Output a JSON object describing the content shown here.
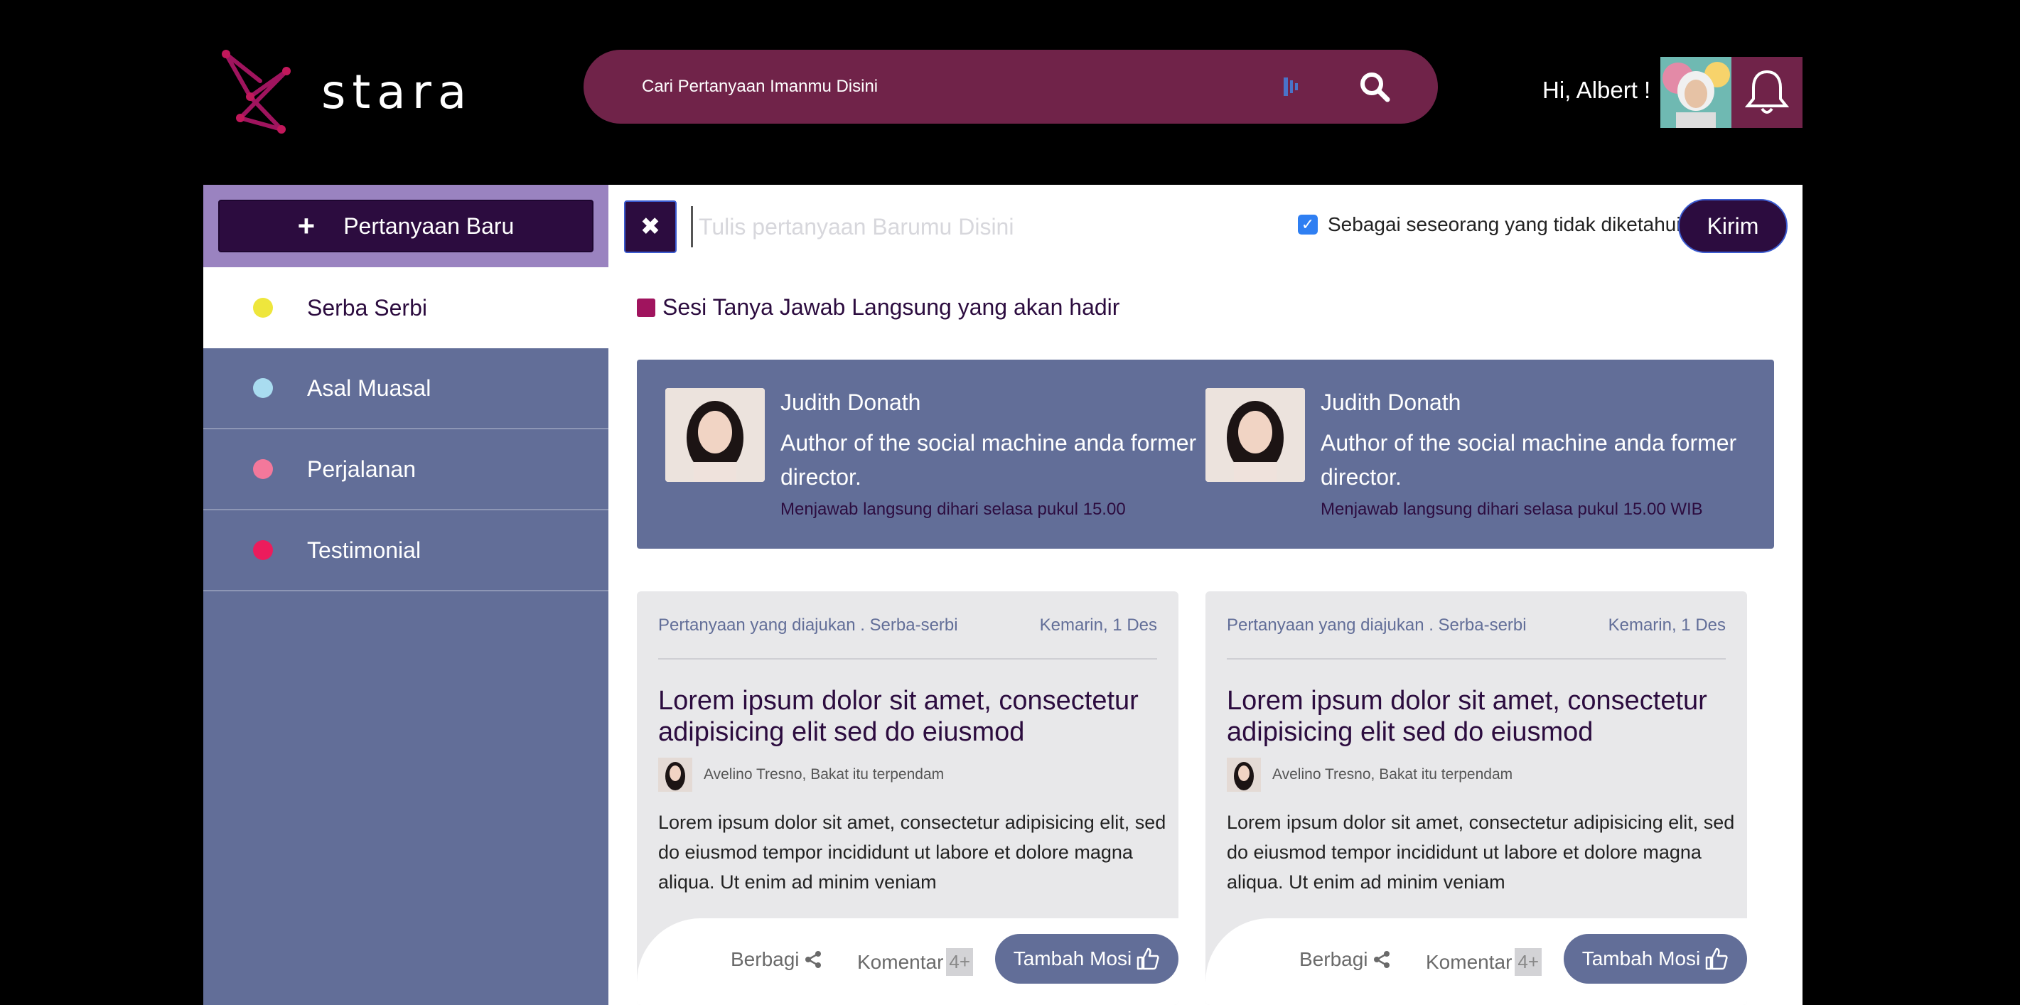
{
  "header": {
    "logo_text": "stara",
    "search_placeholder": "Cari Pertanyaan Imanmu Disini",
    "greeting": "Hi, Albert !"
  },
  "sidebar": {
    "new_question_label": "Pertanyaan Baru",
    "items": [
      {
        "label": "Serba Serbi",
        "color": "#eee63c"
      },
      {
        "label": "Asal Muasal",
        "color": "#a9dcf0"
      },
      {
        "label": "Perjalanan",
        "color": "#f3789b"
      },
      {
        "label": "Testimonial",
        "color": "#ec1c5c"
      }
    ]
  },
  "composer": {
    "placeholder": "Tulis pertanyaan Barumu Disini",
    "anonymous_label": "Sebagai seseorang yang tidak diketahui",
    "anonymous_checked": true,
    "send_label": "Kirim"
  },
  "live_section": {
    "title": "Sesi Tanya Jawab Langsung yang akan hadir",
    "speakers": [
      {
        "name": "Judith Donath",
        "role": "Author of the social machine anda former director.",
        "time": "Menjawab langsung dihari selasa pukul 15.00"
      },
      {
        "name": "Judith Donath",
        "role": "Author of the social machine anda former director.",
        "time": "Menjawab langsung dihari selasa pukul 15.00 WIB"
      }
    ]
  },
  "cards": [
    {
      "meta_left": "Pertanyaan yang diajukan . Serba-serbi",
      "meta_right": "Kemarin, 1 Des",
      "title": "Lorem ipsum dolor sit amet, consectetur adipisicing elit sed do eiusmod",
      "author": "Avelino Tresno, Bakat itu terpendam",
      "body": "Lorem ipsum dolor sit amet, consectetur adipisicing elit, sed do eiusmod tempor incididunt ut labore et dolore magna aliqua. Ut enim ad minim veniam",
      "share_label": "Berbagi",
      "comment_label": "Komentar",
      "comment_count": "4+",
      "upvote_label": "Tambah Mosi"
    },
    {
      "meta_left": "Pertanyaan yang diajukan . Serba-serbi",
      "meta_right": "Kemarin, 1 Des",
      "title": "Lorem ipsum dolor sit amet, consectetur adipisicing elit sed do eiusmod",
      "author": "Avelino Tresno, Bakat itu terpendam",
      "body": "Lorem ipsum dolor sit amet, consectetur adipisicing elit, sed do eiusmod tempor incididunt ut labore et dolore magna aliqua. Ut enim ad minim veniam",
      "share_label": "Berbagi",
      "comment_label": "Komentar",
      "comment_count": "4+",
      "upvote_label": "Tambah Mosi"
    }
  ],
  "colors": {
    "brand_dark": "#2c0c3f",
    "brand_magenta": "#702349",
    "slate": "#626e98",
    "lavender": "#9a83c0"
  }
}
